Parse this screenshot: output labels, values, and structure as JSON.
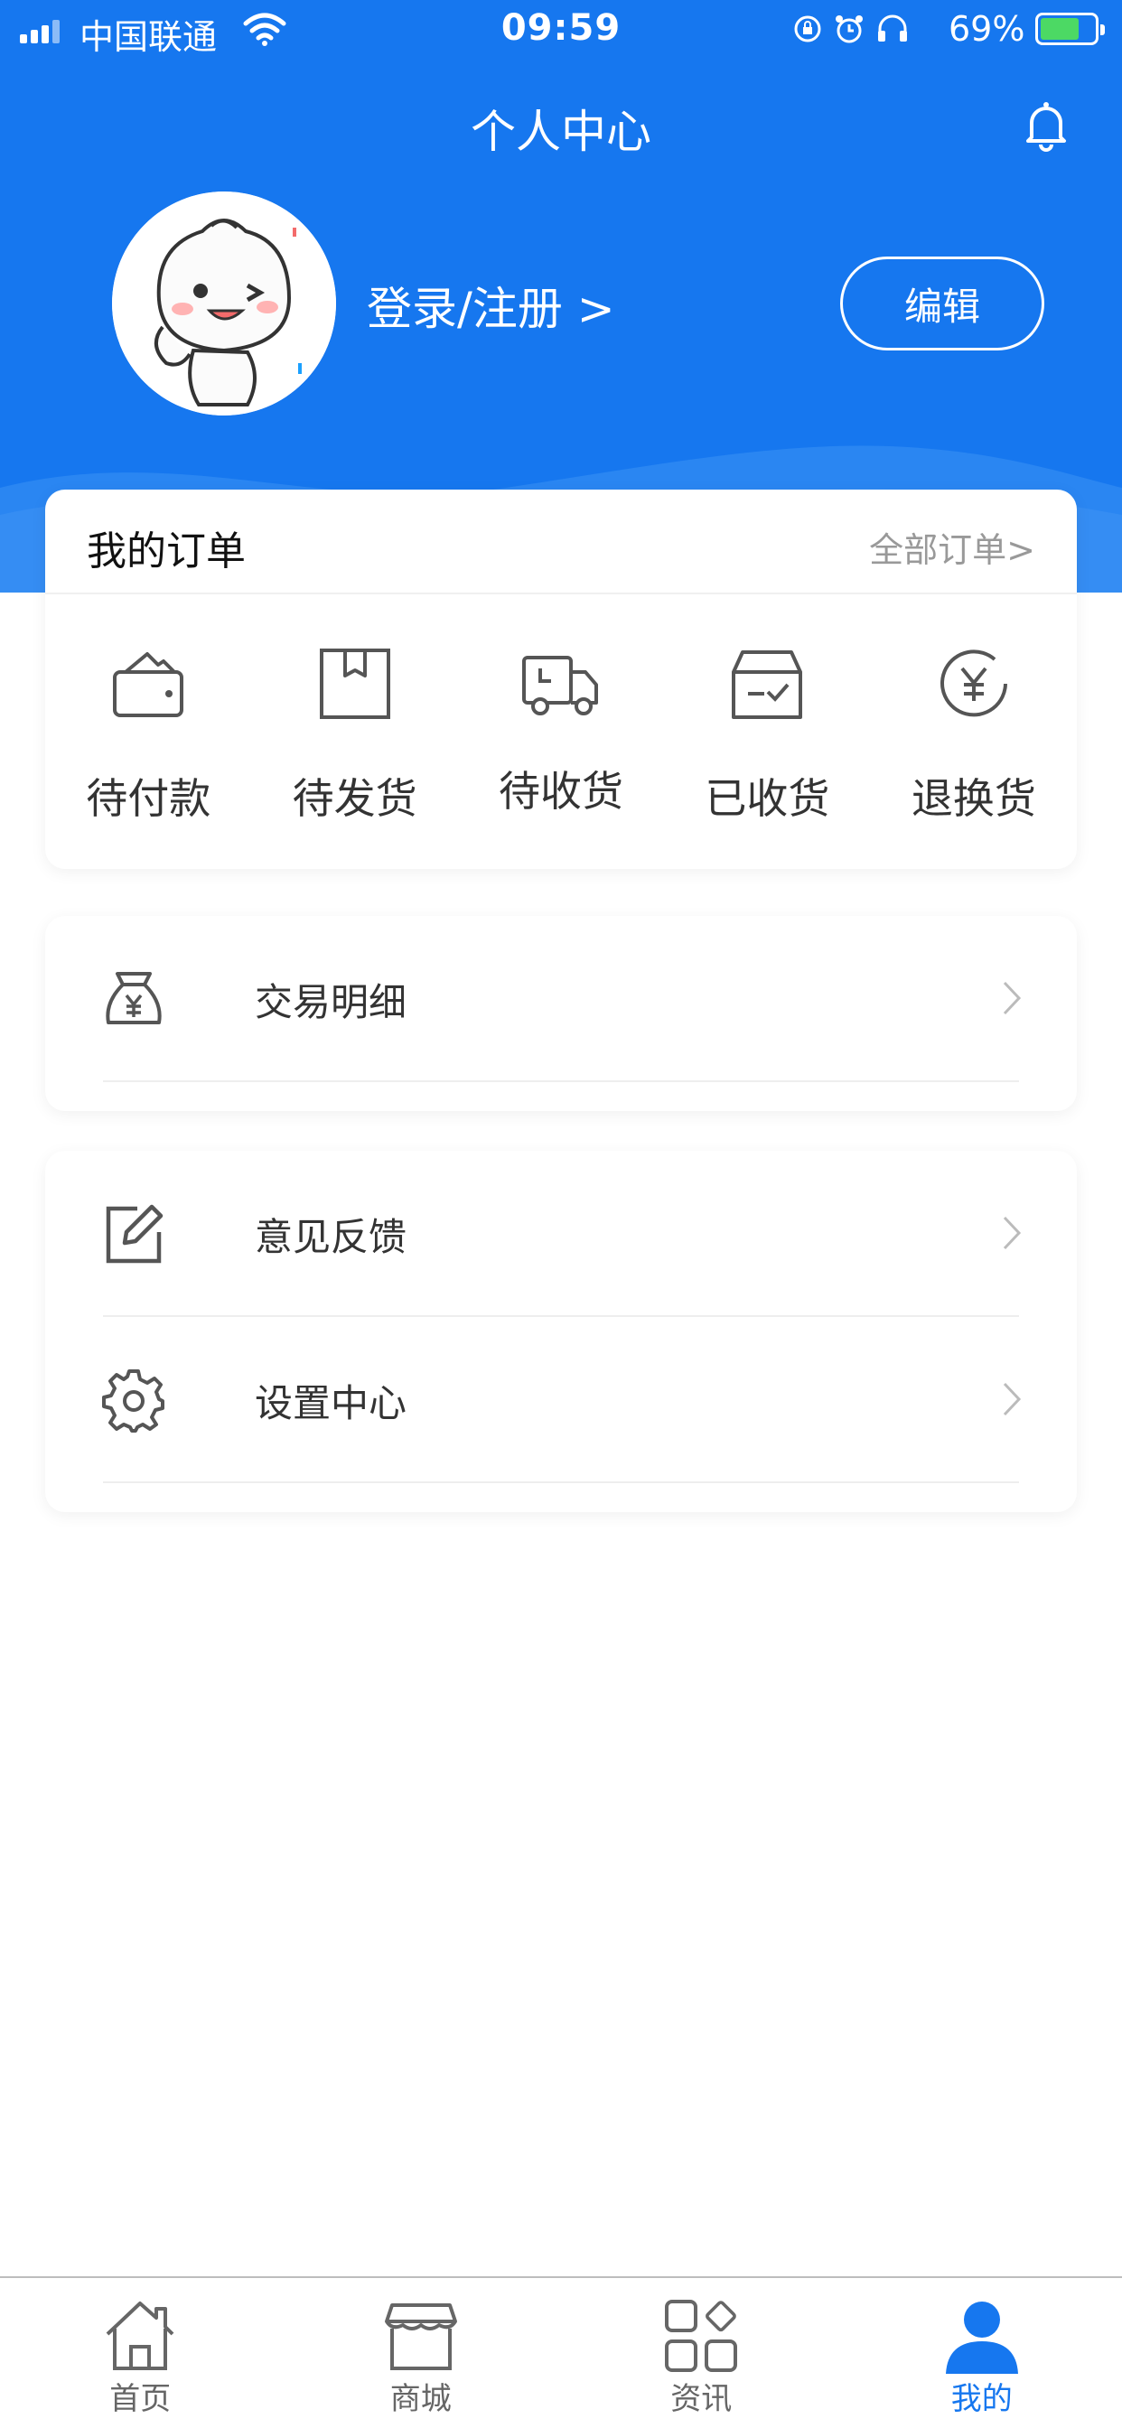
{
  "status_bar": {
    "carrier": "中国联通",
    "time": "09:59",
    "battery": "69%"
  },
  "header": {
    "title": "个人中心",
    "login_text": "登录/注册 >",
    "edit_label": "编辑",
    "accent_color": "#1677ef"
  },
  "orders": {
    "title": "我的订单",
    "all_link": "全部订单>",
    "items": [
      {
        "label": "待付款",
        "icon": "wallet-icon"
      },
      {
        "label": "待发货",
        "icon": "package-icon"
      },
      {
        "label": "待收货",
        "icon": "truck-icon"
      },
      {
        "label": "已收货",
        "icon": "box-check-icon"
      },
      {
        "label": "退换货",
        "icon": "yen-circle-icon"
      }
    ]
  },
  "menu": {
    "transactions": {
      "label": "交易明细",
      "icon": "money-bag-icon"
    },
    "feedback": {
      "label": "意见反馈",
      "icon": "edit-icon"
    },
    "settings": {
      "label": "设置中心",
      "icon": "gear-icon"
    }
  },
  "tabbar": {
    "items": [
      {
        "label": "首页",
        "icon": "home-icon"
      },
      {
        "label": "商城",
        "icon": "store-icon"
      },
      {
        "label": "资讯",
        "icon": "grid-icon"
      },
      {
        "label": "我的",
        "icon": "user-icon",
        "active": true
      }
    ]
  }
}
